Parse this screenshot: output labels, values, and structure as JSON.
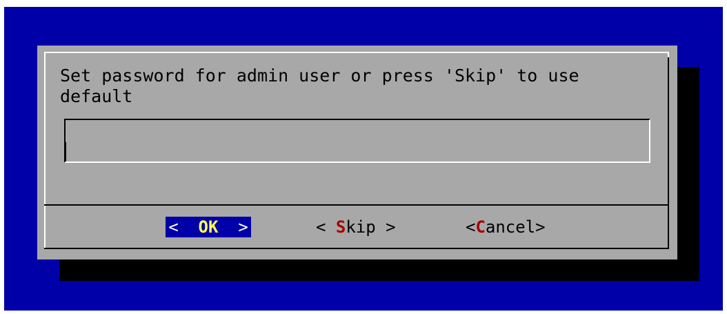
{
  "dialog": {
    "prompt": "Set password for admin user or press 'Skip' to use\ndefault",
    "password_value": ""
  },
  "buttons": {
    "ok": {
      "open": "<  ",
      "hot": "OK",
      "close": "  >"
    },
    "skip": {
      "open": "< ",
      "hot": "S",
      "rest": "kip",
      "close": " >"
    },
    "cancel": {
      "open": "<",
      "hot": "C",
      "rest": "ancel",
      "close": ">"
    }
  },
  "colors": {
    "screen_background": "#0000a8",
    "dialog_background": "#a8a8a8",
    "shadow": "#000000",
    "focused_button_background": "#0000a8",
    "focused_hotkey": "#ffff54",
    "hotkey": "#a80000"
  }
}
